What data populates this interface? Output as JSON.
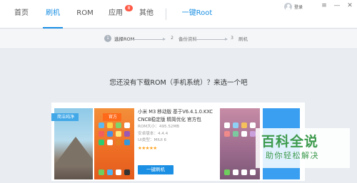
{
  "nav": {
    "tabs": [
      {
        "label": "首页"
      },
      {
        "label": "刷机"
      },
      {
        "label": "ROM"
      },
      {
        "label": "应用",
        "badge": "8"
      },
      {
        "label": "其他"
      }
    ],
    "root_label": "一键Root",
    "login_label": "登录",
    "window": {
      "menu_icon": "≡",
      "minimize_icon": "—",
      "close_icon": "✕"
    }
  },
  "steps": [
    {
      "number": "1",
      "label": "选择ROM"
    },
    {
      "number": "2",
      "label": "备份资料"
    },
    {
      "number": "3",
      "label": "刷机"
    }
  ],
  "question": "您还没有下载ROM（手机系统）？来选一个吧",
  "cards": {
    "tag1": "简洁纯净",
    "tag2": "官方",
    "rom_name": "小米 M3 移动版 基于V6.4.1.0.KXC",
    "rom_desc": "CNCB稳定版 精简优化 官方包",
    "rom_size": "ROM大小：495.52MB",
    "android_version": "安卓版本：4.4.4",
    "ui_type": "UI类型：MIUI 6",
    "rating": "★★★★★",
    "flash_button": "一键刷机"
  },
  "watermark": {
    "main": "百科全说",
    "sub": "助你轻松解决"
  },
  "colors": {
    "accent": "#1a8fe3",
    "badge": "#ff5a46",
    "official_tag": "#ff6a1a",
    "watermark": "#3c9a4c"
  }
}
